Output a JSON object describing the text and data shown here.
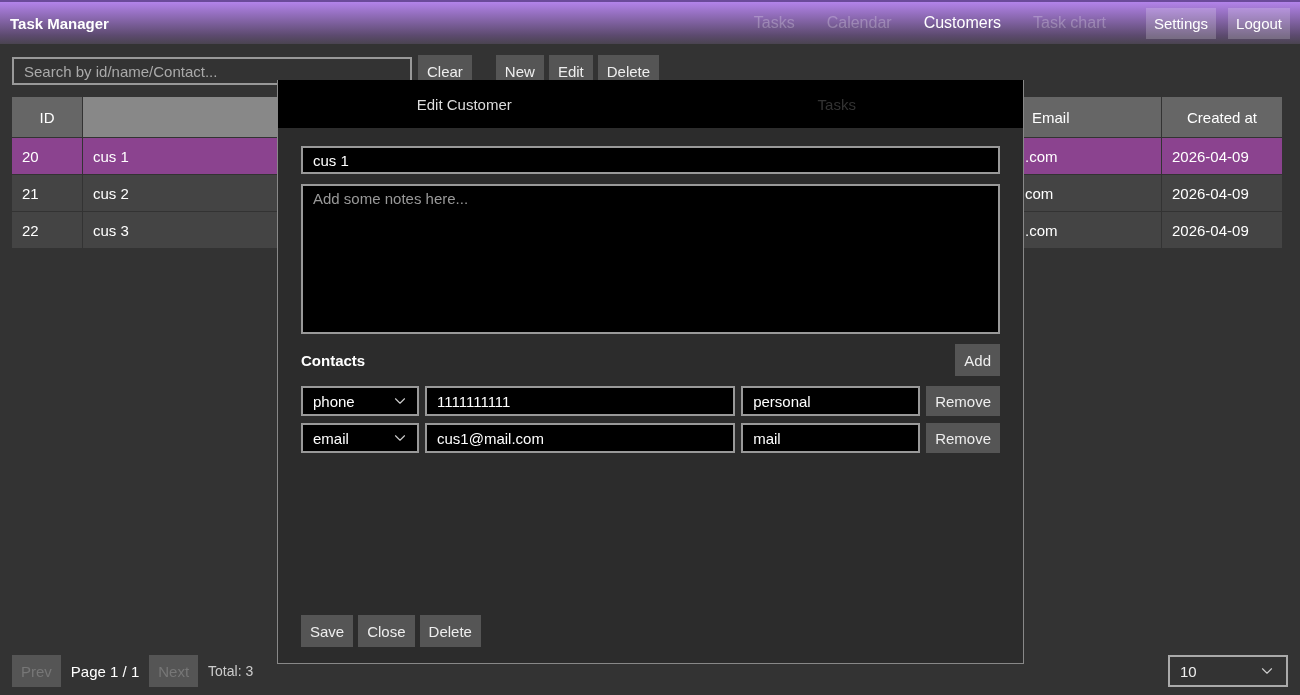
{
  "app": {
    "title": "Task Manager"
  },
  "nav": [
    {
      "label": "Tasks",
      "selected": false
    },
    {
      "label": "Calendar",
      "selected": false
    },
    {
      "label": "Customers",
      "selected": true
    },
    {
      "label": "Task chart",
      "selected": false
    }
  ],
  "header_buttons": [
    "Settings",
    "Logout"
  ],
  "search": {
    "placeholder": "Search by id/name/Contact..."
  },
  "clear_button": "Clear",
  "actions": [
    "New",
    "Edit",
    "Delete"
  ],
  "table": {
    "columns": [
      "ID",
      "",
      "Email",
      "Created at"
    ],
    "rows": [
      {
        "cells": [
          "20",
          "cus 1",
          ".com",
          "2026-04-09"
        ],
        "selected": true
      },
      {
        "cells": [
          "21",
          "cus 2",
          "com",
          "2026-04-09"
        ],
        "selected": false
      },
      {
        "cells": [
          "22",
          "cus 3",
          ".com",
          "2026-04-09"
        ],
        "selected": false
      }
    ]
  },
  "modal": {
    "tabs": [
      {
        "label": "Edit Customer",
        "selected": true
      },
      {
        "label": "Tasks",
        "selected": false
      }
    ],
    "name": "cus 1",
    "notes_placeholder": "Add some notes here...",
    "contacts_title": "Contacts",
    "add_button": "Add",
    "contacts": [
      {
        "type": "phone",
        "value": "1111111111",
        "label": "personal",
        "remove": "Remove"
      },
      {
        "type": "email",
        "value": "cus1@mail.com",
        "label": "mail",
        "remove": "Remove"
      }
    ],
    "buttons": [
      "Save",
      "Close",
      "Delete"
    ]
  },
  "pagination": {
    "prev": {
      "label": "Prev",
      "disabled": true
    },
    "page": "Page 1 / 1",
    "next": {
      "label": "Next",
      "disabled": true
    },
    "total": "Total: 3",
    "page_size": "10"
  }
}
